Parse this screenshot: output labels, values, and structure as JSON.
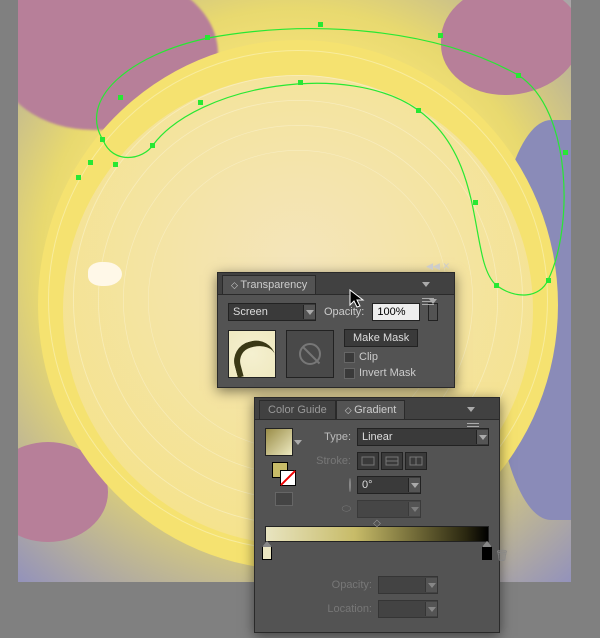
{
  "transparency_panel": {
    "title": "Transparency",
    "blend_mode": "Screen",
    "opacity_label": "Opacity:",
    "opacity_value": "100%",
    "make_mask_label": "Make Mask",
    "clip_label": "Clip",
    "invert_mask_label": "Invert Mask"
  },
  "gradient_panel": {
    "tab_colorguide": "Color Guide",
    "tab_gradient": "Gradient",
    "type_label": "Type:",
    "type_value": "Linear",
    "stroke_label": "Stroke:",
    "angle_value": "0°",
    "opacity_label": "Opacity:",
    "opacity_value": "",
    "location_label": "Location:",
    "location_value": ""
  }
}
